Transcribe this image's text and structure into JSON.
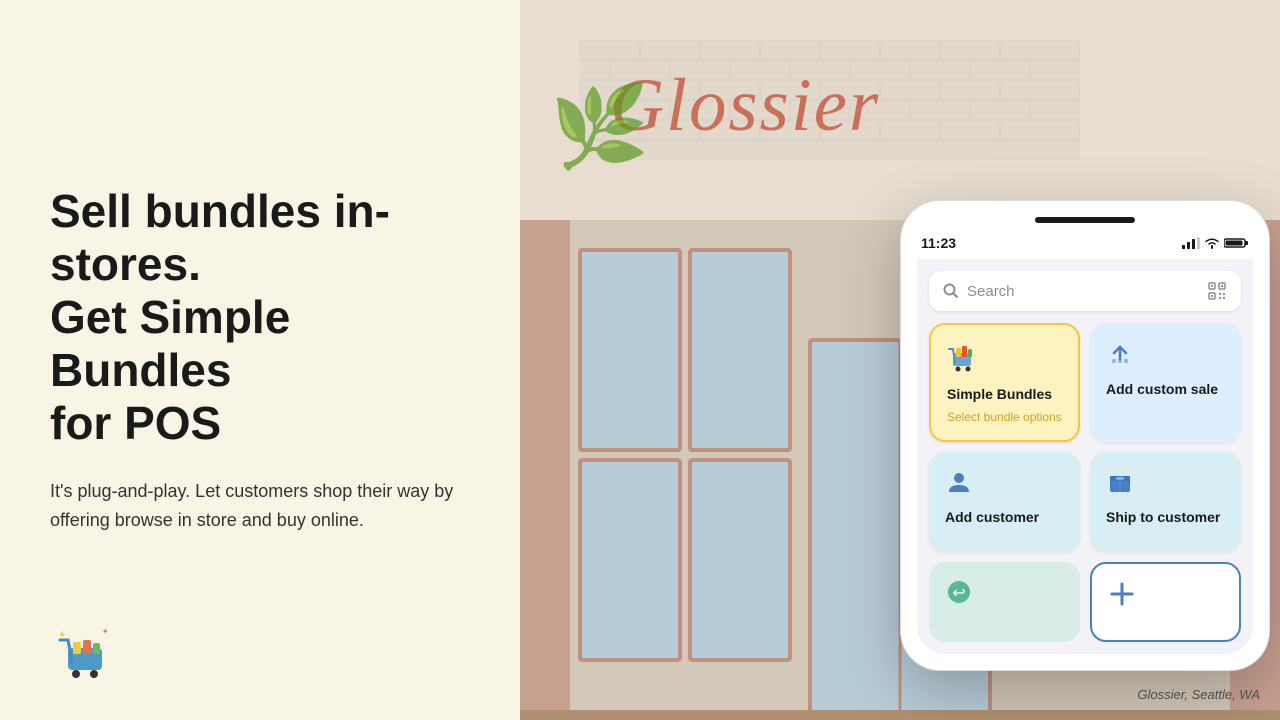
{
  "page": {
    "background_color": "#f8f5e6"
  },
  "left": {
    "headline_line1": "Sell bundles in-stores.",
    "headline_line2": "Get Simple Bundles",
    "headline_line3": "for POS",
    "subtext": "It's plug-and-play. Let customers shop their way by offering browse in store and buy online."
  },
  "phone": {
    "status_bar": {
      "time": "11:23",
      "signal_icon": "●●●",
      "wifi_icon": "wifi",
      "battery_icon": "battery"
    },
    "search": {
      "placeholder": "Search"
    },
    "tiles": [
      {
        "id": "simple-bundles",
        "name": "Simple Bundles",
        "subtitle": "Select bundle options",
        "icon": "🛒",
        "style": "highlighted"
      },
      {
        "id": "add-custom-sale",
        "name": "Add custom sale",
        "icon": "⬆",
        "style": "blue"
      },
      {
        "id": "add-customer",
        "name": "Add customer",
        "icon": "👤",
        "style": "blue-teal"
      },
      {
        "id": "ship-to-customer",
        "name": "Ship to customer",
        "icon": "📦",
        "style": "blue-teal"
      }
    ],
    "bottom_tiles": [
      {
        "id": "discount",
        "icon": "↩",
        "style": "mint"
      },
      {
        "id": "add",
        "icon": "+",
        "style": "outline"
      }
    ]
  },
  "store": {
    "name": "Glossier",
    "caption": "Glossier, Seattle, WA"
  },
  "logo": {
    "emoji": "🛒"
  }
}
